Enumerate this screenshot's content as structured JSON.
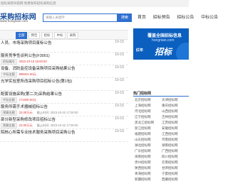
{
  "topbar": {
    "text": "招标采购导航网 免费发布招标采购信息"
  },
  "header": {
    "logo_title": "采购招标网",
    "logo_sub": "www.hongnian.com",
    "search_placeholder": "请输入关键字",
    "search_button": "搜索",
    "nav": [
      "首页",
      "招标预告",
      "招标公告",
      "中标公告"
    ]
  },
  "filters": [
    {
      "label": "全部",
      "active": true
    },
    {
      "label": "预告",
      "active": false
    },
    {
      "label": "招标",
      "active": false
    },
    {
      "label": "中标",
      "active": false
    },
    {
      "label": "采购",
      "active": false
    }
  ],
  "list": [
    {
      "title": "人员、市场采购项目废标公告",
      "time": "10-15",
      "meta": ""
    },
    {
      "title": "服务竞争性谈判公告(F3001)",
      "time": "10-15",
      "label": "招标编号",
      "value": "2023-10-10 18:00:00"
    },
    {
      "title": "设备、消防监控设备采购项目采购结果公告",
      "time": "10-15",
      "label": "中标金额",
      "value": "898201.00元"
    },
    {
      "title": "光学实验室所改采购项目招标公告(第1包)",
      "time": "10-15",
      "label": "",
      "value": ""
    },
    {
      "title": "配套设施采购(第二次)采购结果公告",
      "time": "10-15",
      "label": "中标金额",
      "value": "171000.00元"
    },
    {
      "title": "服务所需手术器械招标公告",
      "time": "10-15",
      "label": "预算金额",
      "value": "23.00万元",
      "extra": "截止时间: 2023-10-22 17:00:00"
    },
    {
      "title": "部分新型采购修改项目招标公告",
      "time": "10-15",
      "label": "预算金额",
      "value": "23.00万元",
      "extra": "截止时间: 2023-10-22 17:00:00"
    },
    {
      "title": "院核心所需专业技术服务采购项目采购公告",
      "time": "10-15",
      "label": "",
      "value": ""
    }
  ],
  "banner": {
    "line1": "覆盖全国招标信息",
    "line2": "hongnian.com",
    "big": "招标",
    "left": "红年"
  },
  "sidebar": {
    "heading": "热门招标网",
    "regions": [
      [
        "北京招标网",
        "天津招标网"
      ],
      [
        "上海招标网",
        "重庆招标网"
      ],
      [
        "河北招标网",
        "山西招标网"
      ],
      [
        "辽宁招标网",
        "吉林招标网"
      ],
      [
        "黑龙江招标网",
        "江苏招标网"
      ],
      [
        "浙江招标网",
        "安徽招标网"
      ],
      [
        "福建招标网",
        "江西招标网"
      ],
      [
        "山东招标网",
        "河南招标网"
      ],
      [
        "湖北招标网",
        "湖南招标网"
      ],
      [
        "广东招标网",
        "广西招标网"
      ],
      [
        "海南招标网",
        "四川招标网"
      ],
      [
        "贵州招标网",
        "云南招标网"
      ],
      [
        "陕西招标网",
        "甘肃招标网"
      ],
      [
        "青海招标网",
        "宁夏招标网"
      ],
      [
        "新疆招标网",
        "西藏招标网"
      ]
    ]
  }
}
